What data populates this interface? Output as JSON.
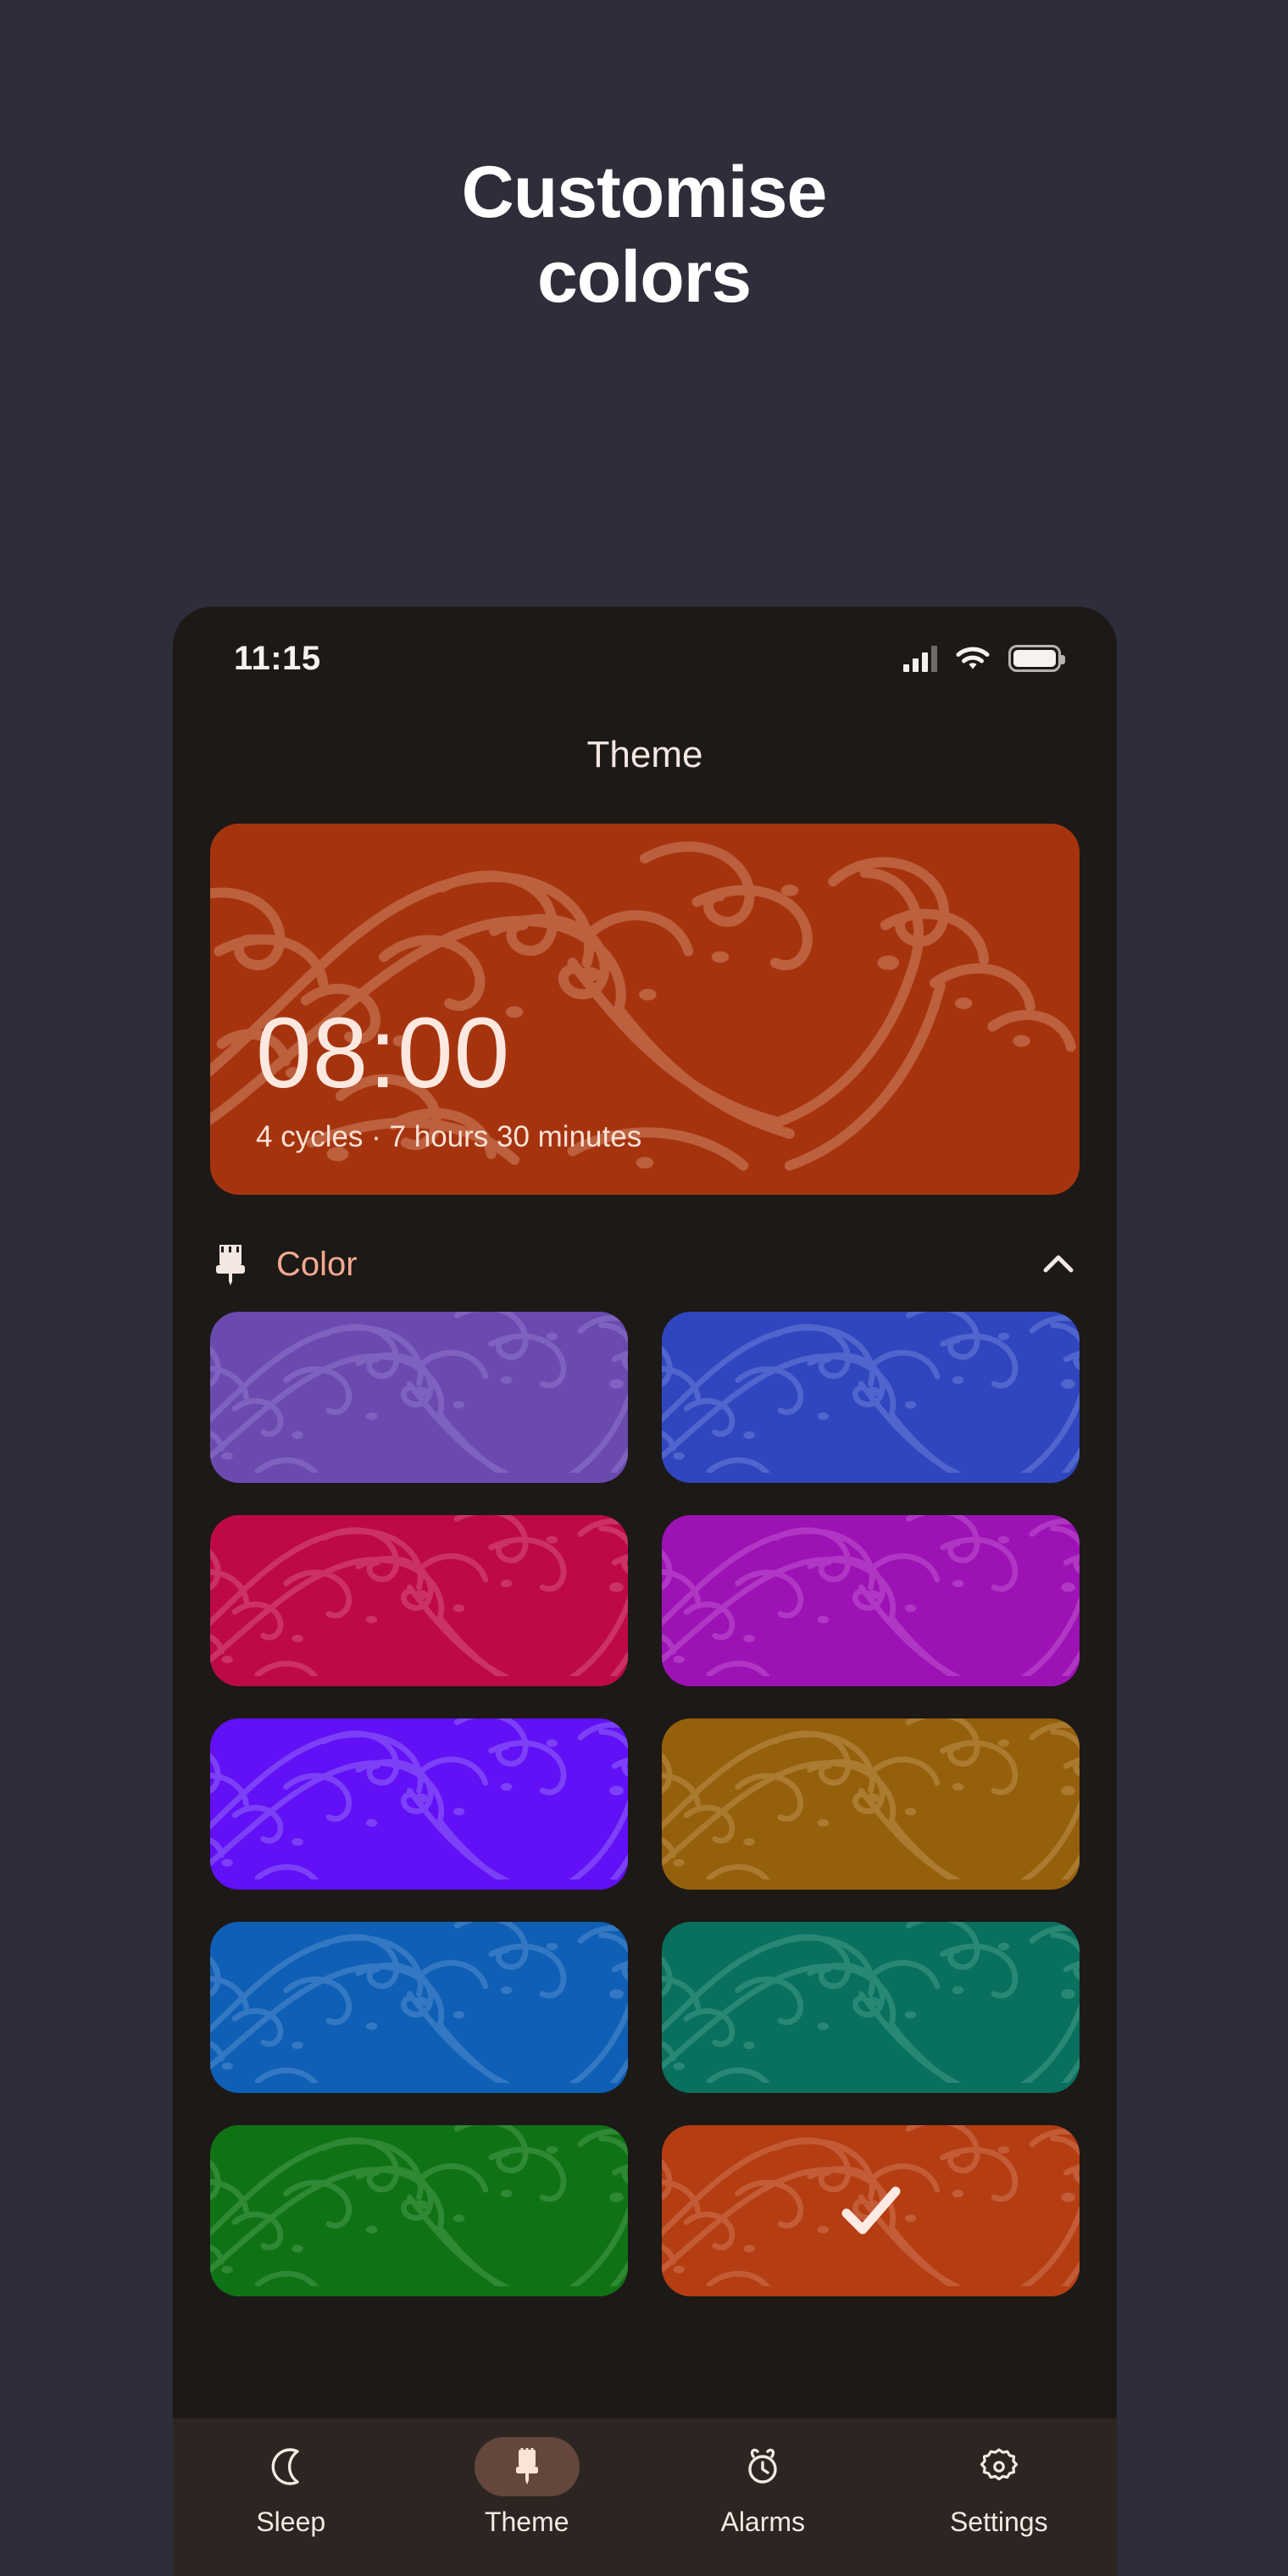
{
  "promo": {
    "line1": "Customise",
    "line2": "colors"
  },
  "theme": {
    "page_background": "#2e2d3a",
    "phone_background": "#1c1917",
    "accent": "#f4a990",
    "tabbar_background": "#2d2522",
    "active_pill": "#63473d"
  },
  "statusbar": {
    "time": "11:15",
    "signal_icon": "cellular-signal-icon",
    "wifi_icon": "wifi-icon",
    "battery_icon": "battery-icon"
  },
  "app": {
    "title": "Theme"
  },
  "hero": {
    "time": "08:00",
    "subtitle": "4 cycles · 7 hours 30 minutes",
    "color": "#a5340e"
  },
  "color_section": {
    "icon": "paintbrush-icon",
    "label": "Color",
    "expanded": true,
    "collapse_icon": "chevron-up-icon"
  },
  "swatches": [
    {
      "name": "purple",
      "color": "#6b4ab0",
      "wave": "#9b84d4",
      "selected": false
    },
    {
      "name": "royal-blue",
      "color": "#2f46bf",
      "wave": "#7f92e0",
      "selected": false
    },
    {
      "name": "crimson",
      "color": "#bd0a46",
      "wave": "#e06a91",
      "selected": false
    },
    {
      "name": "magenta",
      "color": "#9c12b5",
      "wave": "#cc6ad9",
      "selected": false
    },
    {
      "name": "violet",
      "color": "#6210f5",
      "wave": "#a183fb",
      "selected": false
    },
    {
      "name": "amber-brown",
      "color": "#95600b",
      "wave": "#c9a163",
      "selected": false
    },
    {
      "name": "ocean-blue",
      "color": "#0e5fb5",
      "wave": "#6a9cd9",
      "selected": false
    },
    {
      "name": "teal",
      "color": "#08705d",
      "wave": "#57a896",
      "selected": false
    },
    {
      "name": "green",
      "color": "#0f7316",
      "wave": "#5ba860",
      "selected": false
    },
    {
      "name": "orange-red",
      "color": "#b43d12",
      "wave": "#d9886a",
      "selected": true
    }
  ],
  "tabs": [
    {
      "id": "sleep",
      "label": "Sleep",
      "icon": "moon-icon",
      "active": false
    },
    {
      "id": "theme",
      "label": "Theme",
      "icon": "paintbrush-icon",
      "active": true
    },
    {
      "id": "alarms",
      "label": "Alarms",
      "icon": "alarm-clock-icon",
      "active": false
    },
    {
      "id": "settings",
      "label": "Settings",
      "icon": "gear-icon",
      "active": false
    }
  ]
}
